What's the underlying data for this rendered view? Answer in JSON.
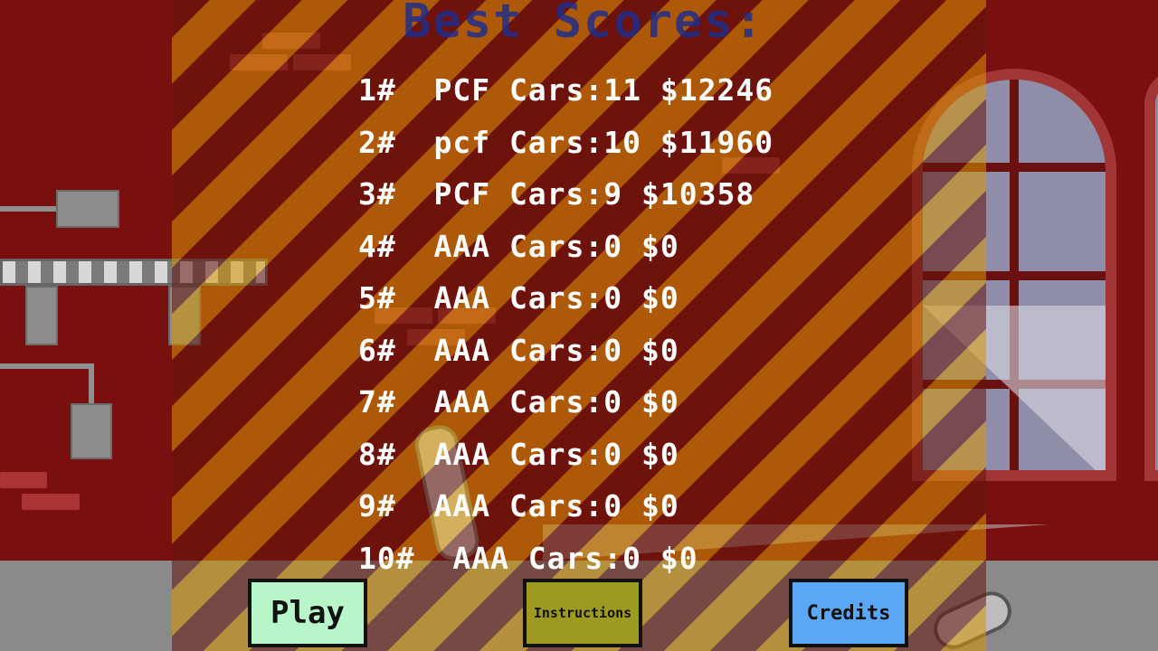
{
  "title": "Best Scores:",
  "scores": [
    {
      "rank": "1#",
      "text": "1#  PCF Cars:11 $12246"
    },
    {
      "rank": "2#",
      "text": "2#  pcf Cars:10 $11960"
    },
    {
      "rank": "3#",
      "text": "3#  PCF Cars:9 $10358"
    },
    {
      "rank": "4#",
      "text": "4#  AAA Cars:0 $0"
    },
    {
      "rank": "5#",
      "text": "5#  AAA Cars:0 $0"
    },
    {
      "rank": "6#",
      "text": "6#  AAA Cars:0 $0"
    },
    {
      "rank": "7#",
      "text": "7#  AAA Cars:0 $0"
    },
    {
      "rank": "8#",
      "text": "8#  AAA Cars:0 $0"
    },
    {
      "rank": "9#",
      "text": "9#  AAA Cars:0 $0"
    },
    {
      "rank": "10#",
      "text": "10#  AAA Cars:0 $0"
    }
  ],
  "buttons": {
    "play": {
      "label": "Play",
      "color": "#b8f5c8"
    },
    "instructions": {
      "label": "Instructions",
      "color": "#9c9a20"
    },
    "credits": {
      "label": "Credits",
      "color": "#5aa8f5"
    }
  },
  "colors": {
    "title": "#1f2e8a",
    "wall": "#7a0f0f",
    "stripe": "#d79600"
  }
}
